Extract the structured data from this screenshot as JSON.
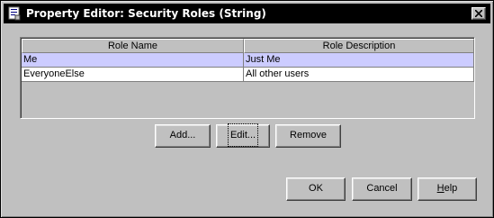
{
  "window": {
    "title": "Property Editor: Security Roles (String)"
  },
  "table": {
    "columns": [
      "Role Name",
      "Role Description"
    ],
    "rows": [
      {
        "name": "Me",
        "description": "Just Me",
        "selected": true
      },
      {
        "name": "EveryoneElse",
        "description": "All other users",
        "selected": false
      }
    ]
  },
  "actions": {
    "add_label": "Add...",
    "edit_label": "Edit...",
    "remove_label": "Remove"
  },
  "footer": {
    "ok_label": "OK",
    "cancel_label": "Cancel",
    "help_label_first": "H",
    "help_label_rest": "elp"
  },
  "colors": {
    "titlebar": "#000000",
    "selection": "#ccccff",
    "dialog_bg": "#c0c0c0"
  },
  "icons": {
    "app": "property-editor-icon",
    "close": "close-icon"
  }
}
